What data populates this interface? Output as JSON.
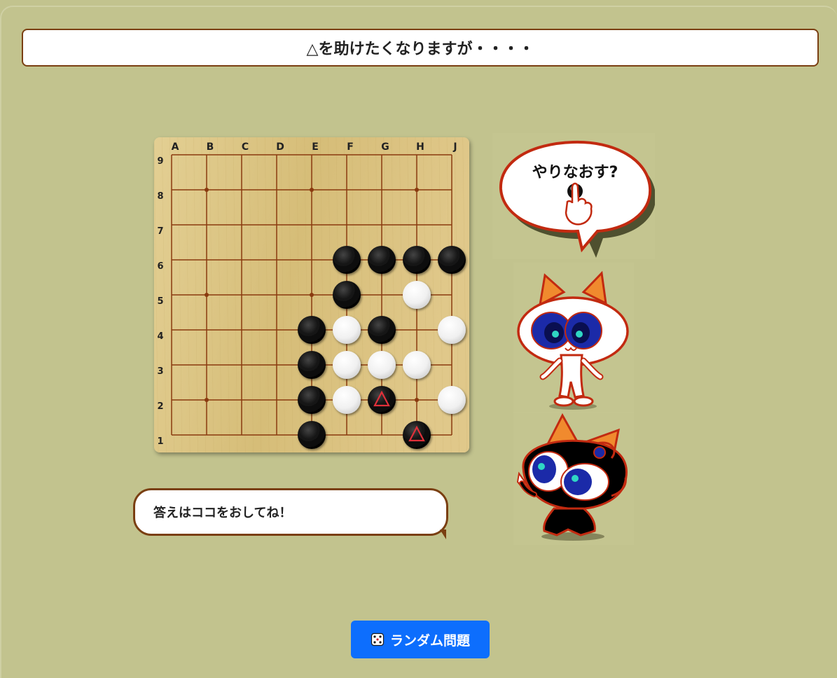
{
  "title": "△を助けたくなりますが・・・・",
  "board": {
    "columns": [
      "A",
      "B",
      "C",
      "D",
      "E",
      "F",
      "G",
      "H",
      "J"
    ],
    "rows": [
      "9",
      "8",
      "7",
      "6",
      "5",
      "4",
      "3",
      "2",
      "1"
    ],
    "hoshi": [
      "B8",
      "E8",
      "H8",
      "B5",
      "E5",
      "B2",
      "H2"
    ],
    "stones": [
      {
        "pos": "F6",
        "color": "black"
      },
      {
        "pos": "G6",
        "color": "black"
      },
      {
        "pos": "H6",
        "color": "black"
      },
      {
        "pos": "J6",
        "color": "black"
      },
      {
        "pos": "F5",
        "color": "black"
      },
      {
        "pos": "H5",
        "color": "white"
      },
      {
        "pos": "E4",
        "color": "black"
      },
      {
        "pos": "F4",
        "color": "white"
      },
      {
        "pos": "G4",
        "color": "black"
      },
      {
        "pos": "J4",
        "color": "white"
      },
      {
        "pos": "E3",
        "color": "black"
      },
      {
        "pos": "F3",
        "color": "white"
      },
      {
        "pos": "G3",
        "color": "white"
      },
      {
        "pos": "H3",
        "color": "white"
      },
      {
        "pos": "E2",
        "color": "black"
      },
      {
        "pos": "F2",
        "color": "white"
      },
      {
        "pos": "G2",
        "color": "black",
        "mark": "triangle"
      },
      {
        "pos": "J2",
        "color": "white"
      },
      {
        "pos": "E1",
        "color": "black"
      },
      {
        "pos": "H1",
        "color": "black",
        "mark": "triangle"
      }
    ],
    "colors": {
      "line": "#8a3a0f",
      "wood": "#dcc483",
      "mark": "#e0303a"
    }
  },
  "answer_bubble": "答えはココをおしてね！",
  "retry_bubble": "やりなおす?",
  "random_button": {
    "icon": "dice-icon",
    "label": "ランダム問題",
    "color": "#0d6efd"
  }
}
